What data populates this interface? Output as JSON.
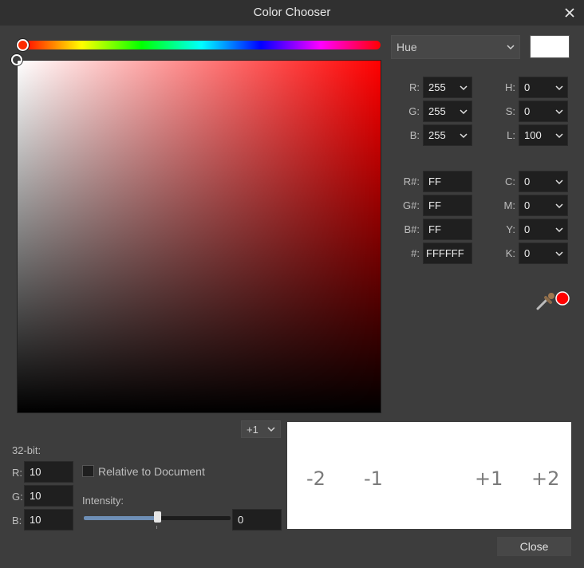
{
  "window": {
    "title": "Color Chooser"
  },
  "mode_select": {
    "value": "Hue"
  },
  "current_color": "#ffffff",
  "rgb": {
    "r_label": "R:",
    "r_value": "255",
    "g_label": "G:",
    "g_value": "255",
    "b_label": "B:",
    "b_value": "255"
  },
  "hsl": {
    "h_label": "H:",
    "h_value": "0",
    "s_label": "S:",
    "s_value": "0",
    "l_label": "L:",
    "l_value": "100"
  },
  "hex": {
    "r_label": "R#:",
    "r_value": "FF",
    "g_label": "G#:",
    "g_value": "FF",
    "b_label": "B#:",
    "b_value": "FF",
    "all_label": "#:",
    "all_value": "FFFFFF"
  },
  "cmyk": {
    "c_label": "C:",
    "c_value": "0",
    "m_label": "M:",
    "m_value": "0",
    "y_label": "Y:",
    "y_value": "0",
    "k_label": "K:",
    "k_value": "0"
  },
  "picker": {
    "selected_color": "#ff0000"
  },
  "bit32": {
    "label": "32-bit:",
    "r_label": "R:",
    "r_value": "10",
    "g_label": "G:",
    "g_value": "10",
    "b_label": "B:",
    "b_value": "10",
    "relative_label": "Relative to Document",
    "relative_checked": false,
    "intensity_label": "Intensity:",
    "intensity_value": "0",
    "intensity_fraction": 0.5
  },
  "step_select": {
    "value": "+1"
  },
  "preview": {
    "labels": [
      "-2",
      "-1",
      "+1",
      "+2"
    ]
  },
  "buttons": {
    "close_label": "Close"
  }
}
